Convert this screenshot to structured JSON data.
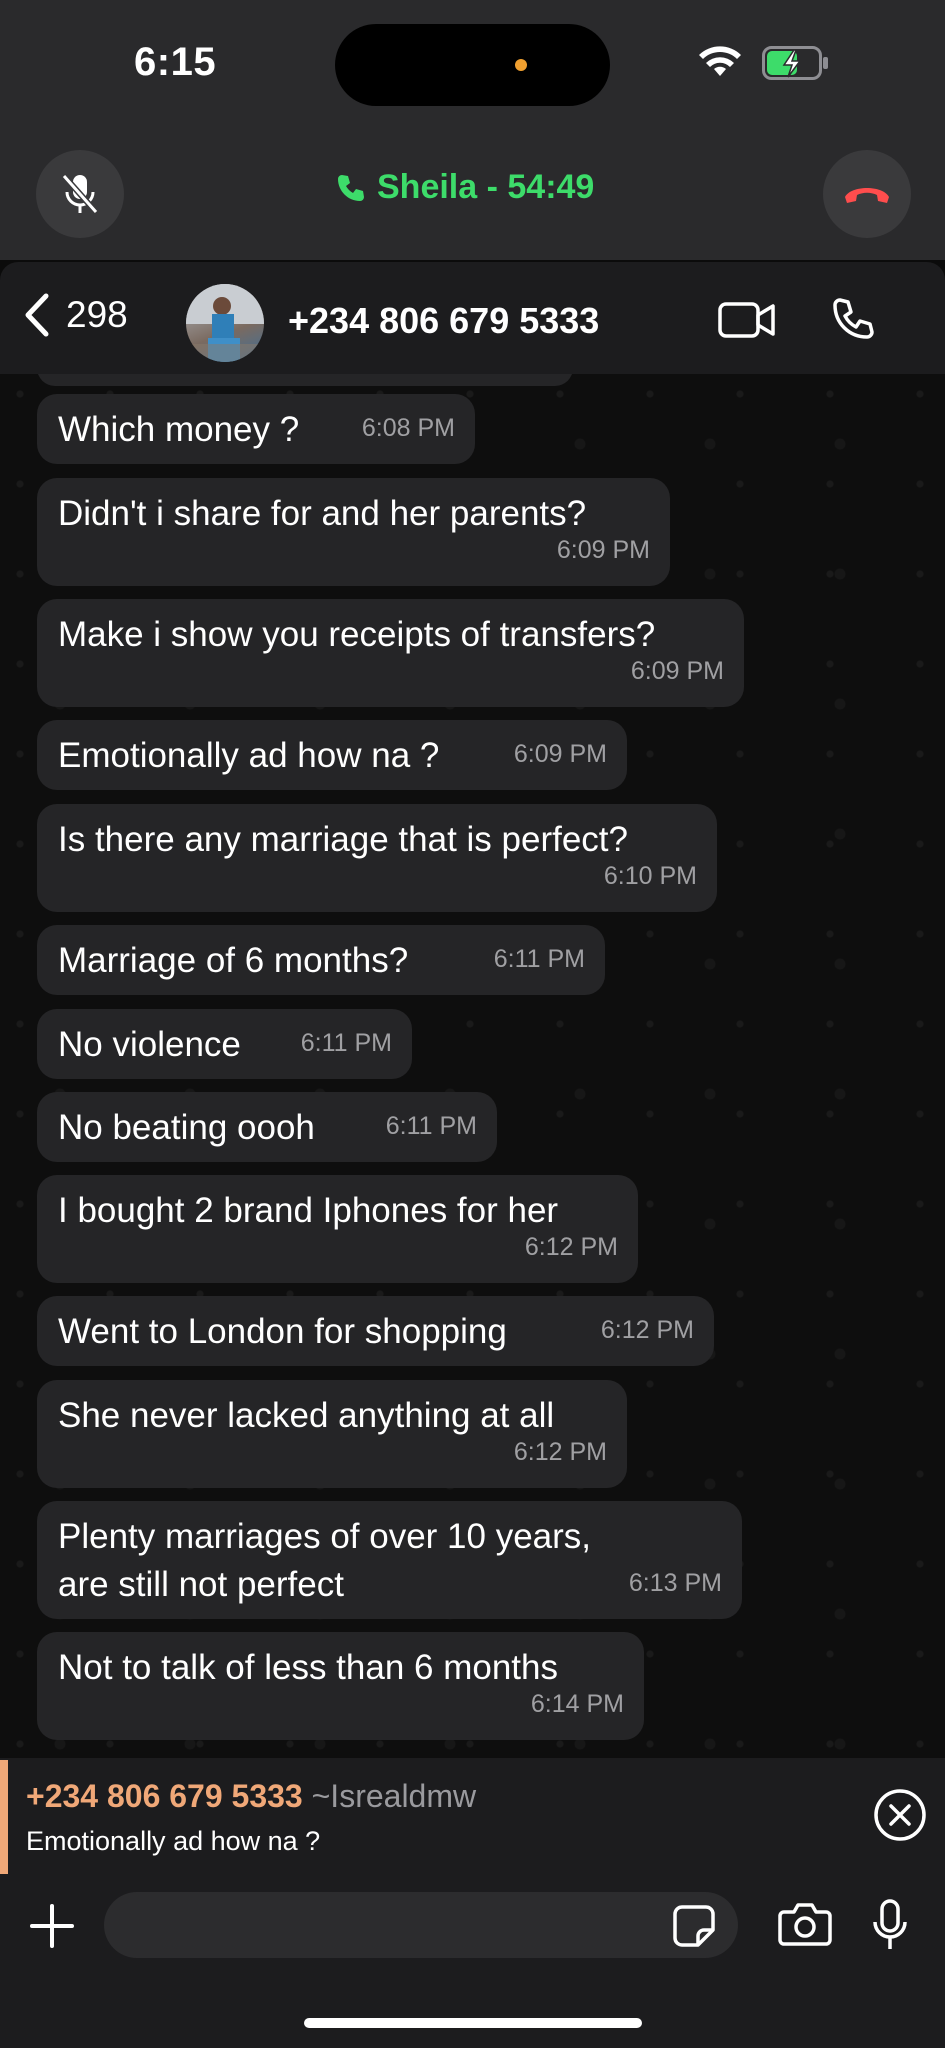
{
  "status_bar": {
    "time": "6:15"
  },
  "call_bar": {
    "title": "Sheila - 54:49",
    "accent": "#3ddc6a"
  },
  "header": {
    "back_count": "298",
    "contact": "+234 806 679 5333"
  },
  "messages": [
    {
      "text": "Which money ?",
      "time": "6:08 PM"
    },
    {
      "text": "Didn't i share for and her parents?",
      "time": "6:09 PM"
    },
    {
      "text": "Make i show you receipts of transfers?",
      "time": "6:09 PM"
    },
    {
      "text": "Emotionally ad how na ?",
      "time": "6:09 PM"
    },
    {
      "text": "Is there any marriage that is perfect?",
      "time": "6:10 PM"
    },
    {
      "text": "Marriage of 6 months?",
      "time": "6:11 PM"
    },
    {
      "text": "No violence",
      "time": "6:11 PM"
    },
    {
      "text": "No beating oooh",
      "time": "6:11 PM"
    },
    {
      "text": "I bought 2 brand Iphones for her",
      "time": "6:12 PM"
    },
    {
      "text": "Went to London for shopping",
      "time": "6:12 PM"
    },
    {
      "text": "She never lacked anything at all",
      "time": "6:12 PM"
    },
    {
      "text": "Plenty marriages of over 10 years, are still not perfect",
      "time": "6:13 PM"
    },
    {
      "text": "Not to talk of less than 6 months",
      "time": "6:14 PM"
    }
  ],
  "reply_preview": {
    "number": "+234 806 679 5333",
    "name": "~Isrealdmw",
    "quote": "Emotionally ad how na ?",
    "accent": "#f0a878"
  },
  "input": {
    "placeholder": ""
  }
}
